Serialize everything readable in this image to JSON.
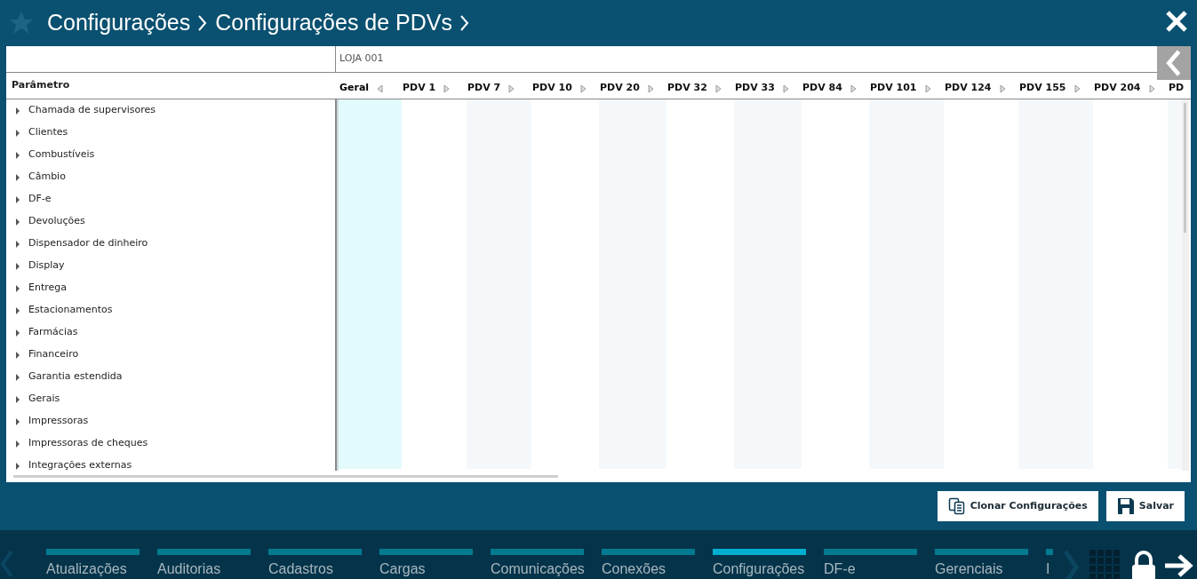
{
  "breadcrumb": [
    "Configurações",
    "Configurações de PDVs"
  ],
  "store": "LOJA 001",
  "param_header": "Parâmetro",
  "columns": [
    {
      "label": "Geral",
      "selected": true,
      "expanded": true
    },
    {
      "label": "PDV 1",
      "selected": false,
      "expanded": false
    },
    {
      "label": "PDV 7",
      "selected": false,
      "expanded": false
    },
    {
      "label": "PDV 10",
      "selected": false,
      "expanded": false
    },
    {
      "label": "PDV 20",
      "selected": false,
      "expanded": false
    },
    {
      "label": "PDV 32",
      "selected": false,
      "expanded": false
    },
    {
      "label": "PDV 33",
      "selected": false,
      "expanded": false
    },
    {
      "label": "PDV 84",
      "selected": false,
      "expanded": false
    },
    {
      "label": "PDV 101",
      "selected": false,
      "expanded": false
    },
    {
      "label": "PDV 124",
      "selected": false,
      "expanded": false
    },
    {
      "label": "PDV 155",
      "selected": false,
      "expanded": false
    },
    {
      "label": "PDV 204",
      "selected": false,
      "expanded": false
    },
    {
      "label": "PD",
      "selected": false
    }
  ],
  "rows": [
    {
      "label": "Chamada de supervisores",
      "expanded": false
    },
    {
      "label": "Clientes",
      "expanded": false
    },
    {
      "label": "Combustíveis",
      "expanded": false
    },
    {
      "label": "Câmbio",
      "expanded": false
    },
    {
      "label": "DF-e",
      "expanded": false
    },
    {
      "label": "Devoluções",
      "expanded": false
    },
    {
      "label": "Dispensador de dinheiro",
      "expanded": false
    },
    {
      "label": "Display",
      "expanded": false
    },
    {
      "label": "Entrega",
      "expanded": false
    },
    {
      "label": "Estacionamentos",
      "expanded": false
    },
    {
      "label": "Farmácias",
      "expanded": false
    },
    {
      "label": "Financeiro",
      "expanded": false
    },
    {
      "label": "Garantia estendida",
      "expanded": false
    },
    {
      "label": "Gerais",
      "expanded": false
    },
    {
      "label": "Impressoras",
      "expanded": false
    },
    {
      "label": "Impressoras de cheques",
      "expanded": false
    },
    {
      "label": "Integrações externas",
      "expanded": false
    }
  ],
  "buttons": [
    {
      "label": "Clonar Configurações",
      "kind": "clone"
    },
    {
      "label": "Salvar",
      "kind": "save"
    }
  ],
  "nav": [
    {
      "label": "Atualizações",
      "selected": false
    },
    {
      "label": "Auditorias",
      "selected": false
    },
    {
      "label": "Cadastros",
      "selected": false
    },
    {
      "label": "Cargas",
      "selected": false
    },
    {
      "label": "Comunicações",
      "selected": false
    },
    {
      "label": "Conexões",
      "selected": false
    },
    {
      "label": "Configurações",
      "selected": true
    },
    {
      "label": "DF-e",
      "selected": false
    },
    {
      "label": "Gerenciais",
      "selected": false
    },
    {
      "label": "I",
      "selected": false
    }
  ]
}
